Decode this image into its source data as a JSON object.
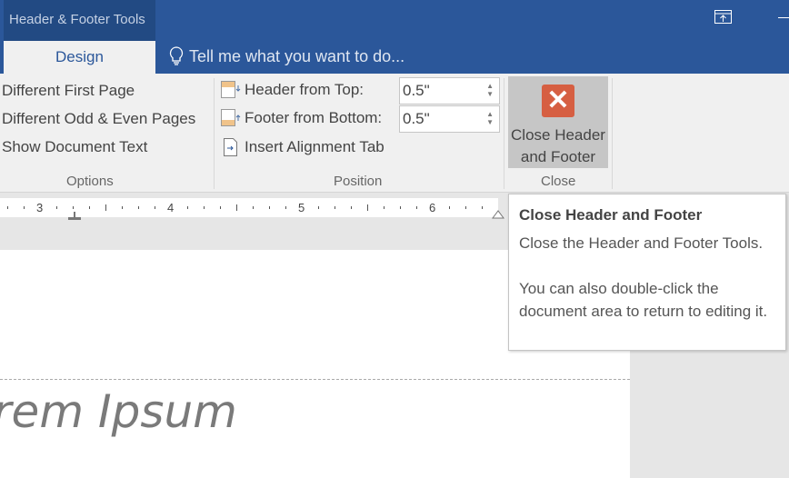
{
  "titlebar": {
    "context_tab": "Header & Footer Tools",
    "tab": "Design",
    "tell_me": "Tell me what you want to do..."
  },
  "options": {
    "items": [
      "Different First Page",
      "Different Odd & Even Pages",
      "Show Document Text"
    ],
    "group": "Options"
  },
  "position": {
    "header_label": "Header from Top:",
    "header_value": "0.5\"",
    "footer_label": "Footer from Bottom:",
    "footer_value": "0.5\"",
    "insert_tab": "Insert Alignment Tab",
    "group": "Position"
  },
  "close": {
    "line1": "Close Header",
    "line2": "and Footer",
    "group": "Close",
    "icon_color": "#d65f42"
  },
  "ruler": {
    "labels": [
      "3",
      "4",
      "5",
      "6"
    ]
  },
  "document": {
    "text": "rem Ipsum"
  },
  "tooltip": {
    "title": "Close Header and Footer",
    "line1": "Close the Header and Footer Tools.",
    "line2": "You can also double-click the document area to return to editing it."
  }
}
